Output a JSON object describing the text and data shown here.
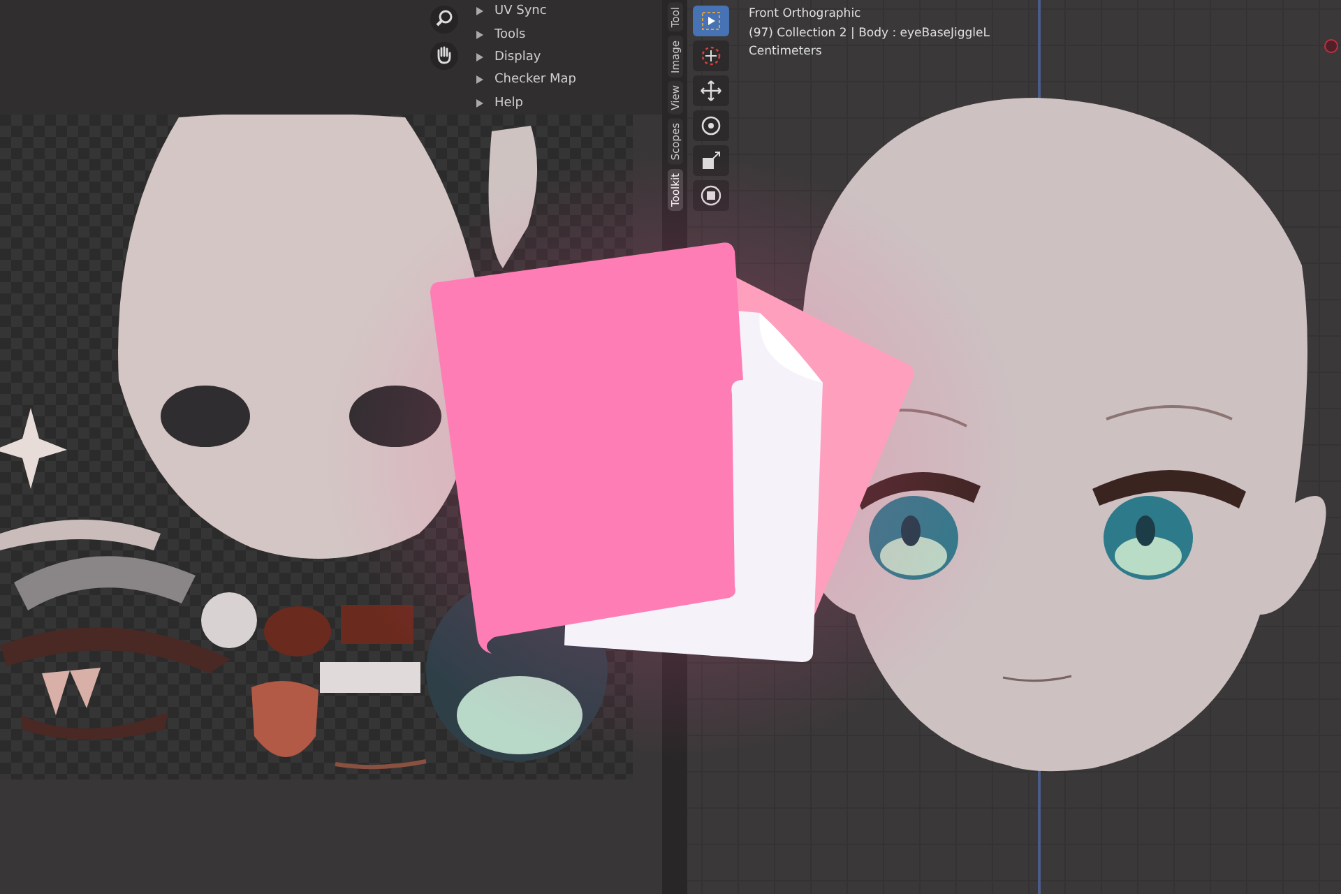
{
  "uv_editor": {
    "menu": [
      {
        "label": "UV Sync",
        "expanded": false
      },
      {
        "label": "Tools",
        "expanded": false
      },
      {
        "label": "Display",
        "expanded": false
      },
      {
        "label": "Checker Map",
        "expanded": false
      },
      {
        "label": "Help",
        "expanded": false
      }
    ]
  },
  "sidebar_tabs": [
    {
      "label": "Tool",
      "selected": false
    },
    {
      "label": "Image",
      "selected": false
    },
    {
      "label": "View",
      "selected": false
    },
    {
      "label": "Scopes",
      "selected": false
    },
    {
      "label": "Toolkit",
      "selected": true
    }
  ],
  "toolbar": [
    {
      "kind": "select",
      "selected": true
    },
    {
      "kind": "cursor",
      "selected": false
    },
    {
      "kind": "move",
      "selected": false
    },
    {
      "kind": "rotate",
      "selected": false
    },
    {
      "kind": "scale",
      "selected": false
    },
    {
      "kind": "transform",
      "selected": false
    }
  ],
  "viewport": {
    "lines": [
      "Front Orthographic",
      "(97) Collection 2 | Body : eyeBaseJiggleL",
      "Centimeters"
    ]
  }
}
